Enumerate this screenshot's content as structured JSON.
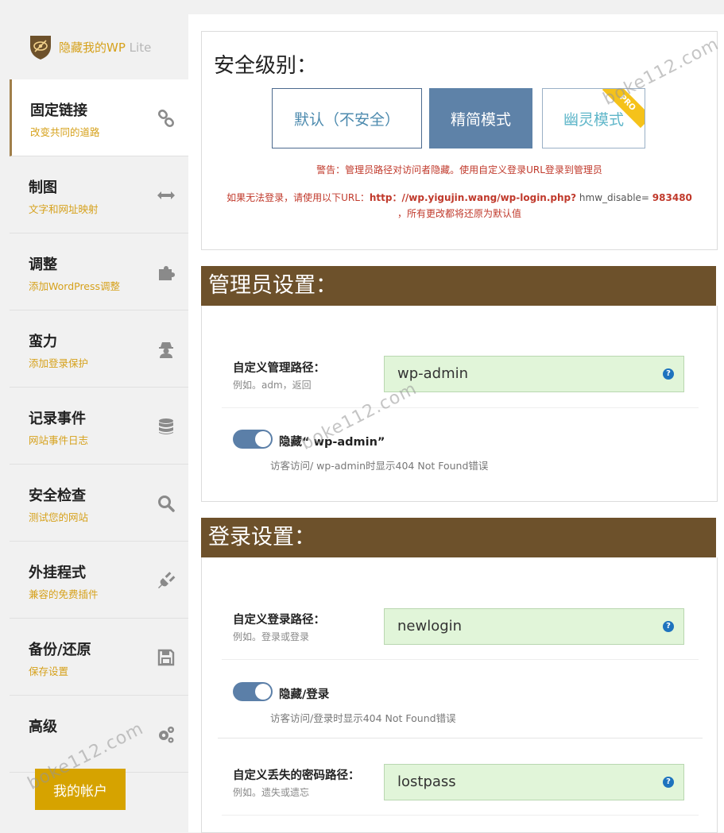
{
  "brand": {
    "name": "隐藏我的WP",
    "edition": "Lite"
  },
  "sidebar": {
    "items": [
      {
        "title": "固定链接",
        "sub": "改变共同的道路",
        "icon": "link-icon"
      },
      {
        "title": "制图",
        "sub": "文字和网址映射",
        "icon": "arrows-horizontal-icon"
      },
      {
        "title": "调整",
        "sub": "添加WordPress调整",
        "icon": "puzzle-icon"
      },
      {
        "title": "蛮力",
        "sub": "添加登录保护",
        "icon": "user-secret-icon"
      },
      {
        "title": "记录事件",
        "sub": "网站事件日志",
        "icon": "database-icon"
      },
      {
        "title": "安全检查",
        "sub": "测试您的网站",
        "icon": "search-icon"
      },
      {
        "title": "外挂程式",
        "sub": "兼容的免费插件",
        "icon": "plug-icon"
      },
      {
        "title": "备份/还原",
        "sub": "保存设置",
        "icon": "floppy-icon"
      },
      {
        "title": "高级",
        "sub": "",
        "icon": "gears-icon"
      }
    ],
    "account_button": "我的帐户"
  },
  "security": {
    "title": "安全级别：",
    "modes": {
      "default": "默认（不安全）",
      "lite": "精简模式",
      "ghost": "幽灵模式"
    },
    "ribbon": "PRO",
    "warning_line": "警告：管理员路径对访问者隐藏。使用自定义登录URL登录到管理员",
    "fallback_prefix": "如果无法登录，请使用以下URL：",
    "fallback_url": "http：//wp.yigujin.wang/wp-login.php?",
    "fallback_param": " hmw_disable= ",
    "fallback_code": "983480",
    "fallback_suffix": "，所有更改都将还原为默认值"
  },
  "admin": {
    "heading": "管理员设置：",
    "path_label": "自定义管理路径：",
    "path_hint": "例如。adm，返回",
    "path_value": "wp-admin",
    "toggle_label": "隐藏“ wp-admin”",
    "toggle_hint": "访客访问/ wp-admin时显示404 Not Found错误"
  },
  "login": {
    "heading": "登录设置：",
    "path_label": "自定义登录路径：",
    "path_hint": "例如。登录或登录",
    "path_value": "newlogin",
    "toggle_label": "隐藏/登录",
    "toggle_hint": "访客访问/登录时显示404 Not Found错误",
    "lost_label": "自定义丢失的密码路径：",
    "lost_hint": "例如。遗失或遗忘",
    "lost_value": "lostpass"
  },
  "help_glyph": "?",
  "watermark": "boke112.com"
}
